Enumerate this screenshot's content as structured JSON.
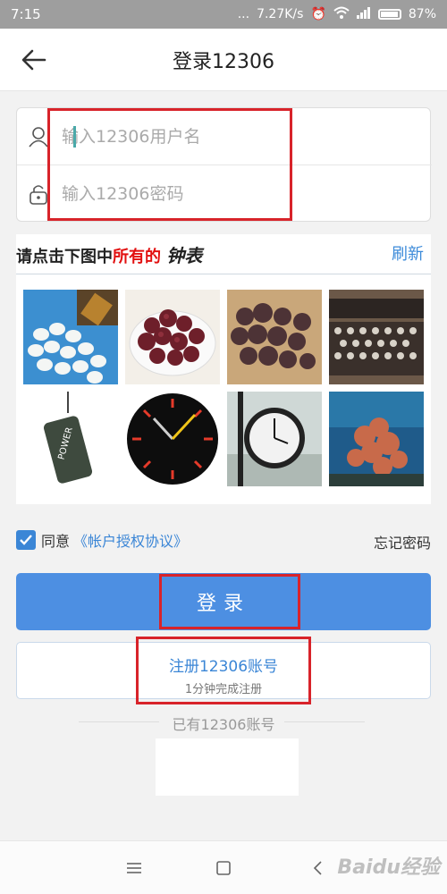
{
  "status_bar": {
    "time": "7:15",
    "dots": "...",
    "net_speed": "7.27K/s",
    "battery": "87%"
  },
  "header": {
    "title": "登录12306",
    "back_icon": "arrow-left-icon"
  },
  "login": {
    "username_placeholder": "输入12306用户名",
    "password_placeholder": "输入12306密码",
    "user_icon": "user-icon",
    "lock_icon": "lock-icon"
  },
  "captcha": {
    "prompt_prefix": "请点击下图中",
    "prompt_highlight": "所有的",
    "prompt_target": "钟表",
    "refresh": "刷新",
    "tiles": [
      "pills",
      "dried-fruit-plate",
      "dried-fruit-pile",
      "typewriter",
      "punching-bag",
      "wall-clock",
      "street-clock",
      "coral-reef"
    ]
  },
  "agreement": {
    "checked": true,
    "agree_label": "同意",
    "agreement_link": "《帐户授权协议》",
    "forgot_password": "忘记密码"
  },
  "actions": {
    "login_label": "登录",
    "register_label": "注册12306账号",
    "register_sub": "1分钟完成注册",
    "have_account": "已有12306账号"
  },
  "navbar": {
    "icons": [
      "menu-icon",
      "home-square-icon",
      "back-chevron-icon"
    ]
  },
  "watermark": "Baidu经验",
  "colors": {
    "accent": "#4d8fe2",
    "link": "#3b86d6",
    "highlight_red": "#d8232a"
  }
}
